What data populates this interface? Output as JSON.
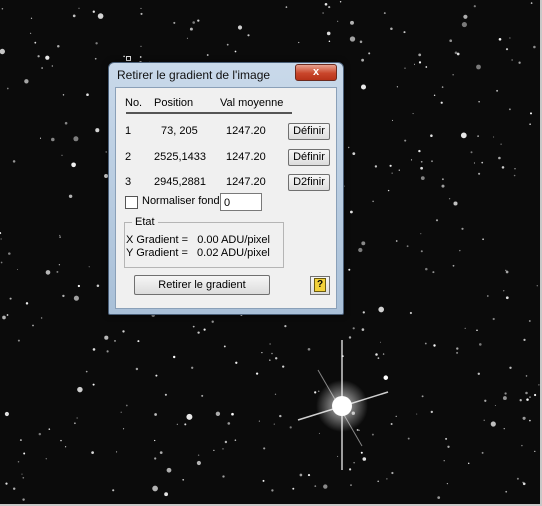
{
  "dialog": {
    "title": "Retirer le gradient de l'image",
    "close_label": "x",
    "columns": [
      "No.",
      "Position",
      "Val moyenne"
    ],
    "rows": [
      {
        "no": "1",
        "position": "73, 205",
        "value": "1247.20",
        "button": "Définir"
      },
      {
        "no": "2",
        "position": "2525,1433",
        "value": "1247.20",
        "button": "Définir"
      },
      {
        "no": "3",
        "position": "2945,2881",
        "value": "1247.20",
        "button": "D2finir"
      }
    ],
    "normaliser_label": "Normaliser fond",
    "normaliser_checked": false,
    "fond_value": "0",
    "etat": {
      "legend": "Etat",
      "x_gradient": "X Gradient =   0.00 ADU/pixel",
      "y_gradient": "Y Gradient =   0.02 ADU/pixel"
    },
    "apply_button": "Retirer le gradient",
    "help_icon": "help-question-icon"
  }
}
